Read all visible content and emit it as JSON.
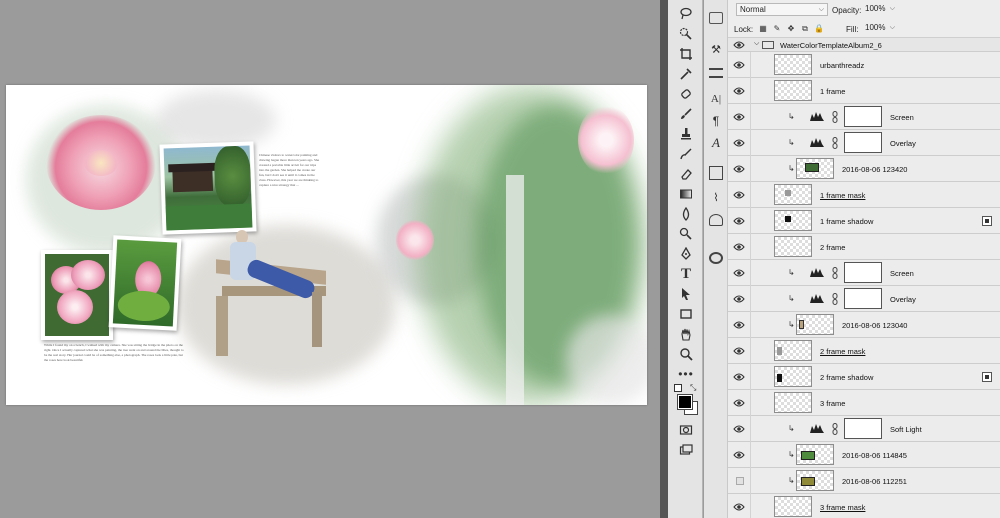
{
  "app": {
    "blend_mode": "Normal",
    "opacity_label": "Opacity:",
    "opacity_value": "100%",
    "lock_label": "Lock:",
    "fill_label": "Fill:",
    "fill_value": "100%"
  },
  "layers": [
    {
      "name": "WaterColorTemplateAlbum2_6",
      "type": "group",
      "visible": true
    },
    {
      "name": "urbanthreadz",
      "type": "layer",
      "visible": true
    },
    {
      "name": "1 frame",
      "type": "layer",
      "visible": true
    },
    {
      "name": "Screen",
      "type": "adjustment",
      "visible": true
    },
    {
      "name": "Overlay",
      "type": "adjustment",
      "visible": true
    },
    {
      "name": "2016-08-06 123420",
      "type": "photo",
      "visible": true
    },
    {
      "name": "1 frame mask",
      "type": "mask",
      "visible": true
    },
    {
      "name": "1 frame shadow",
      "type": "shadow",
      "visible": true
    },
    {
      "name": "2 frame",
      "type": "layer",
      "visible": true
    },
    {
      "name": "Screen",
      "type": "adjustment",
      "visible": true
    },
    {
      "name": "Overlay",
      "type": "adjustment",
      "visible": true
    },
    {
      "name": "2016-08-06 123040",
      "type": "photo",
      "visible": true
    },
    {
      "name": "2 frame mask",
      "type": "mask",
      "visible": true
    },
    {
      "name": "2 frame shadow",
      "type": "shadow",
      "visible": true
    },
    {
      "name": "3 frame",
      "type": "layer",
      "visible": true
    },
    {
      "name": "Soft Light",
      "type": "adjustment",
      "visible": true
    },
    {
      "name": "2016-08-06 114845",
      "type": "photo",
      "visible": true
    },
    {
      "name": "2016-08-06 112251",
      "type": "photo",
      "visible": false
    },
    {
      "name": "3 frame mask",
      "type": "mask",
      "visible": true
    }
  ],
  "document": {
    "journal_top": "Chinese visitors to watercolor painting and drawing began more than ten years ago. She created a portable little art kit for our trips into the garden. She helped me create our fun, but I don't see it until it comes in the class. However, this year we are thinking to capture a nice strategy that ...",
    "journal_bottom": "While I found my on a bench, I walked with my camera. She was sitting the bridge in the photo on the right. Once I actually captured what she was painting, the tree went on and around the lilies, thought to be the real story. Her journal could be of something else, a photograph. The roses look a little pale, but the roses here look beautiful."
  }
}
